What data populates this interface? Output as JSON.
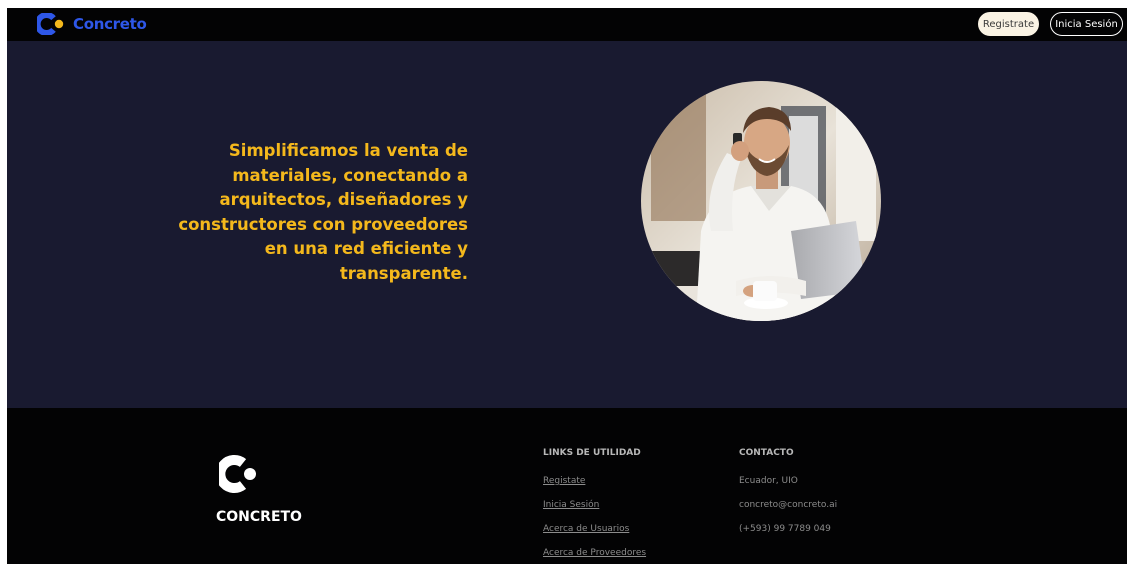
{
  "navbar": {
    "brand_name": "Concreto",
    "register_label": "Registrate",
    "login_label": "Inicia Sesión"
  },
  "hero": {
    "headline": "Simplificamos la venta de materiales, conectando a arquitectos, diseñadores y constructores con proveedores en una red eficiente y transparente."
  },
  "footer": {
    "brand_name": "CONCRETO",
    "links_title": "LINKS DE UTILIDAD",
    "links": [
      "Registate",
      "Inicia Sesión",
      "Acerca de Usuarios",
      "Acerca de Proveedores"
    ],
    "contact_title": "CONTACTO",
    "contact": [
      "Ecuador, UIO",
      "concreto@concreto.ai",
      "(+593) 99 7789 049"
    ]
  },
  "colors": {
    "brand_blue": "#2e57e8",
    "brand_yellow": "#f4b81c",
    "hero_background": "#191a30",
    "footer_background": "#030304"
  },
  "icons": {
    "brand_logo": "concreto-c-dot-icon",
    "footer_logo": "concreto-c-dot-icon"
  }
}
